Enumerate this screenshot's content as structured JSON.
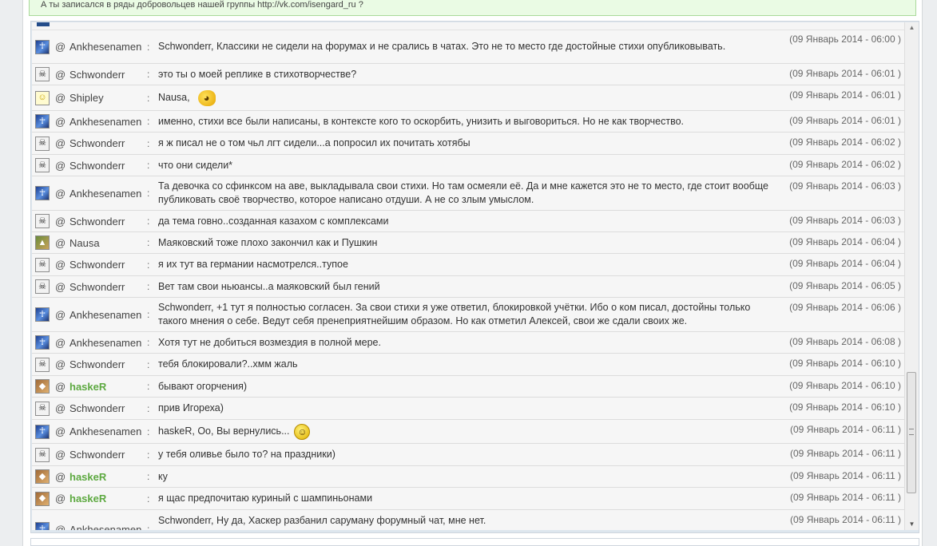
{
  "announcement": {
    "text": "А ты записался в ряды добровольцев нашей группы http://vk.com/isengard_ru ?"
  },
  "at_symbol": "@",
  "separator": ":",
  "messages": [
    {
      "nick": "Ankhesenamen",
      "avatar": "ankh-avatar-icon",
      "text": "Schwonderr, Классики не сидели на форумах и не срались в чатах. Это не то место где достойные стихи опубликовывать.",
      "time": "(09 Январь 2014 - 06:00 )"
    },
    {
      "nick": "Schwonderr",
      "avatar": "skull-avatar-icon",
      "text": "это ты о моей реплике в стихотворчестве?",
      "time": "(09 Январь 2014 - 06:01 )"
    },
    {
      "nick": "Shipley",
      "avatar": "smiley-avatar-icon",
      "text": "Nausa,",
      "emoji": "fish-emoticon-icon",
      "time": "(09 Январь 2014 - 06:01 )"
    },
    {
      "nick": "Ankhesenamen",
      "avatar": "ankh-avatar-icon",
      "text": "именно, стихи все были написаны, в контексте кого то оскорбить, унизить и выговориться. Но не как творчество.",
      "time": "(09 Январь 2014 - 06:01 )"
    },
    {
      "nick": "Schwonderr",
      "avatar": "skull-avatar-icon",
      "text": "я ж писал не о том чьл лгт сидели...а попросил их почитать хотябы",
      "time": "(09 Январь 2014 - 06:02 )"
    },
    {
      "nick": "Schwonderr",
      "avatar": "skull-avatar-icon",
      "text": "что они сидели*",
      "time": "(09 Январь 2014 - 06:02 )"
    },
    {
      "nick": "Ankhesenamen",
      "avatar": "ankh-avatar-icon",
      "text": "Та девочка со сфинксом на аве, выкладывала свои стихи. Но там осмеяли её. Да и мне кажется это не то место, где стоит вообще публиковать своё творчество, которое написано отдуши. А не со злым умыслом.",
      "time": "(09 Январь 2014 - 06:03 )"
    },
    {
      "nick": "Schwonderr",
      "avatar": "skull-avatar-icon",
      "text": "да тема говно..созданная казахом с комплексами",
      "time": "(09 Январь 2014 - 06:03 )"
    },
    {
      "nick": "Nausa",
      "avatar": "landscape-avatar-icon",
      "text": "Маяковский тоже плохо закончил как и Пушкин",
      "time": "(09 Январь 2014 - 06:04 )"
    },
    {
      "nick": "Schwonderr",
      "avatar": "skull-avatar-icon",
      "text": "я их тут ва германии насмотрелся..тупое",
      "time": "(09 Январь 2014 - 06:04 )"
    },
    {
      "nick": "Schwonderr",
      "avatar": "skull-avatar-icon",
      "text": "Вет там свои ньюансы..а маяковский был гений",
      "time": "(09 Январь 2014 - 06:05 )"
    },
    {
      "nick": "Ankhesenamen",
      "avatar": "ankh-avatar-icon",
      "text": "Schwonderr, +1 тут я полностью согласен. За свои стихи я уже ответил, блокировкой учётки. Ибо о ком писал, достойны только такого мнения о себе. Ведут себя пренеприятнейшим образом. Но как отметил Алексей, свои же сдали своих же.",
      "time": "(09 Январь 2014 - 06:06 )"
    },
    {
      "nick": "Ankhesenamen",
      "avatar": "ankh-avatar-icon",
      "text": "Хотя тут не добиться возмездия в полной мере.",
      "time": "(09 Январь 2014 - 06:08 )"
    },
    {
      "nick": "Schwonderr",
      "avatar": "skull-avatar-icon",
      "text": "тебя блокировали?..хмм жаль",
      "time": "(09 Январь 2014 - 06:10 )"
    },
    {
      "nick": "haskeR",
      "avatar": "fox-avatar-icon",
      "text": "бывают огорчения)",
      "time": "(09 Январь 2014 - 06:10 )"
    },
    {
      "nick": "Schwonderr",
      "avatar": "skull-avatar-icon",
      "text": "прив Игореха)",
      "time": "(09 Январь 2014 - 06:10 )"
    },
    {
      "nick": "Ankhesenamen",
      "avatar": "ankh-avatar-icon",
      "text": "haskeR, Оо, Вы вернулись...",
      "emoji": "smile-emoticon-icon",
      "time": "(09 Январь 2014 - 06:11 )"
    },
    {
      "nick": "Schwonderr",
      "avatar": "skull-avatar-icon",
      "text": "у тебя оливье было то? на праздники)",
      "time": "(09 Январь 2014 - 06:11 )"
    },
    {
      "nick": "haskeR",
      "avatar": "fox-avatar-icon",
      "text": "ку",
      "time": "(09 Январь 2014 - 06:11 )"
    },
    {
      "nick": "haskeR",
      "avatar": "fox-avatar-icon",
      "text": "я щас предпочитаю куриный с шампиньонами",
      "time": "(09 Январь 2014 - 06:11 )"
    },
    {
      "nick": "Ankhesenamen",
      "avatar": "ankh-avatar-icon",
      "text": "Schwonderr, Ну да, Хаскер разбанил саруману форумный чат, мне нет.",
      "time": "(09 Январь 2014 - 06:11 )"
    }
  ],
  "scrollbar": {
    "up_icon": "scroll-up-arrow-icon",
    "down_icon": "scroll-down-arrow-icon"
  },
  "colors": {
    "highlight_nick": "#5da940",
    "announcement_bg": "#eafbe4",
    "row_bg": "#f6f6f6"
  }
}
